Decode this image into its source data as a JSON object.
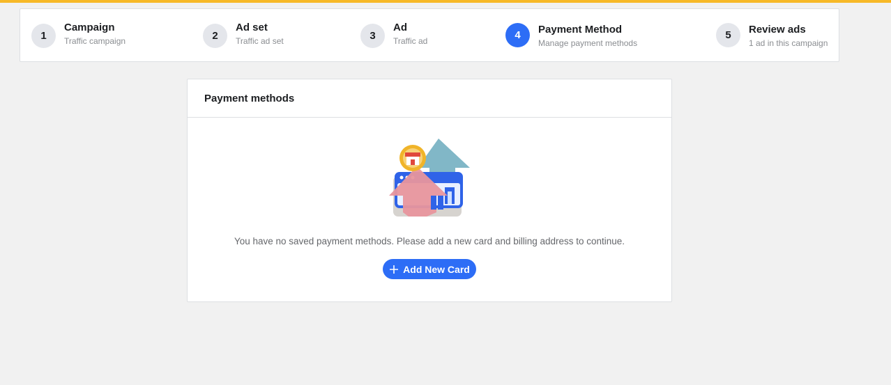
{
  "colors": {
    "accent_bar": "#f7b928",
    "primary": "#2d6df6",
    "inactive_step": "#e4e6eb"
  },
  "stepper": {
    "steps": [
      {
        "number": "1",
        "title": "Campaign",
        "subtitle": "Traffic campaign",
        "active": false
      },
      {
        "number": "2",
        "title": "Ad set",
        "subtitle": "Traffic ad set",
        "active": false
      },
      {
        "number": "3",
        "title": "Ad",
        "subtitle": "Traffic ad",
        "active": false
      },
      {
        "number": "4",
        "title": "Payment Method",
        "subtitle": "Manage payment methods",
        "active": true
      },
      {
        "number": "5",
        "title": "Review ads",
        "subtitle": "1 ad in this campaign",
        "active": false
      }
    ]
  },
  "payment": {
    "title": "Payment methods",
    "illustration": "store-card-arrows-illustration",
    "empty_message": "You have no saved payment methods. Please add a new card and billing address to continue.",
    "add_button_icon": "plus-icon",
    "add_button_label": "Add New Card"
  }
}
